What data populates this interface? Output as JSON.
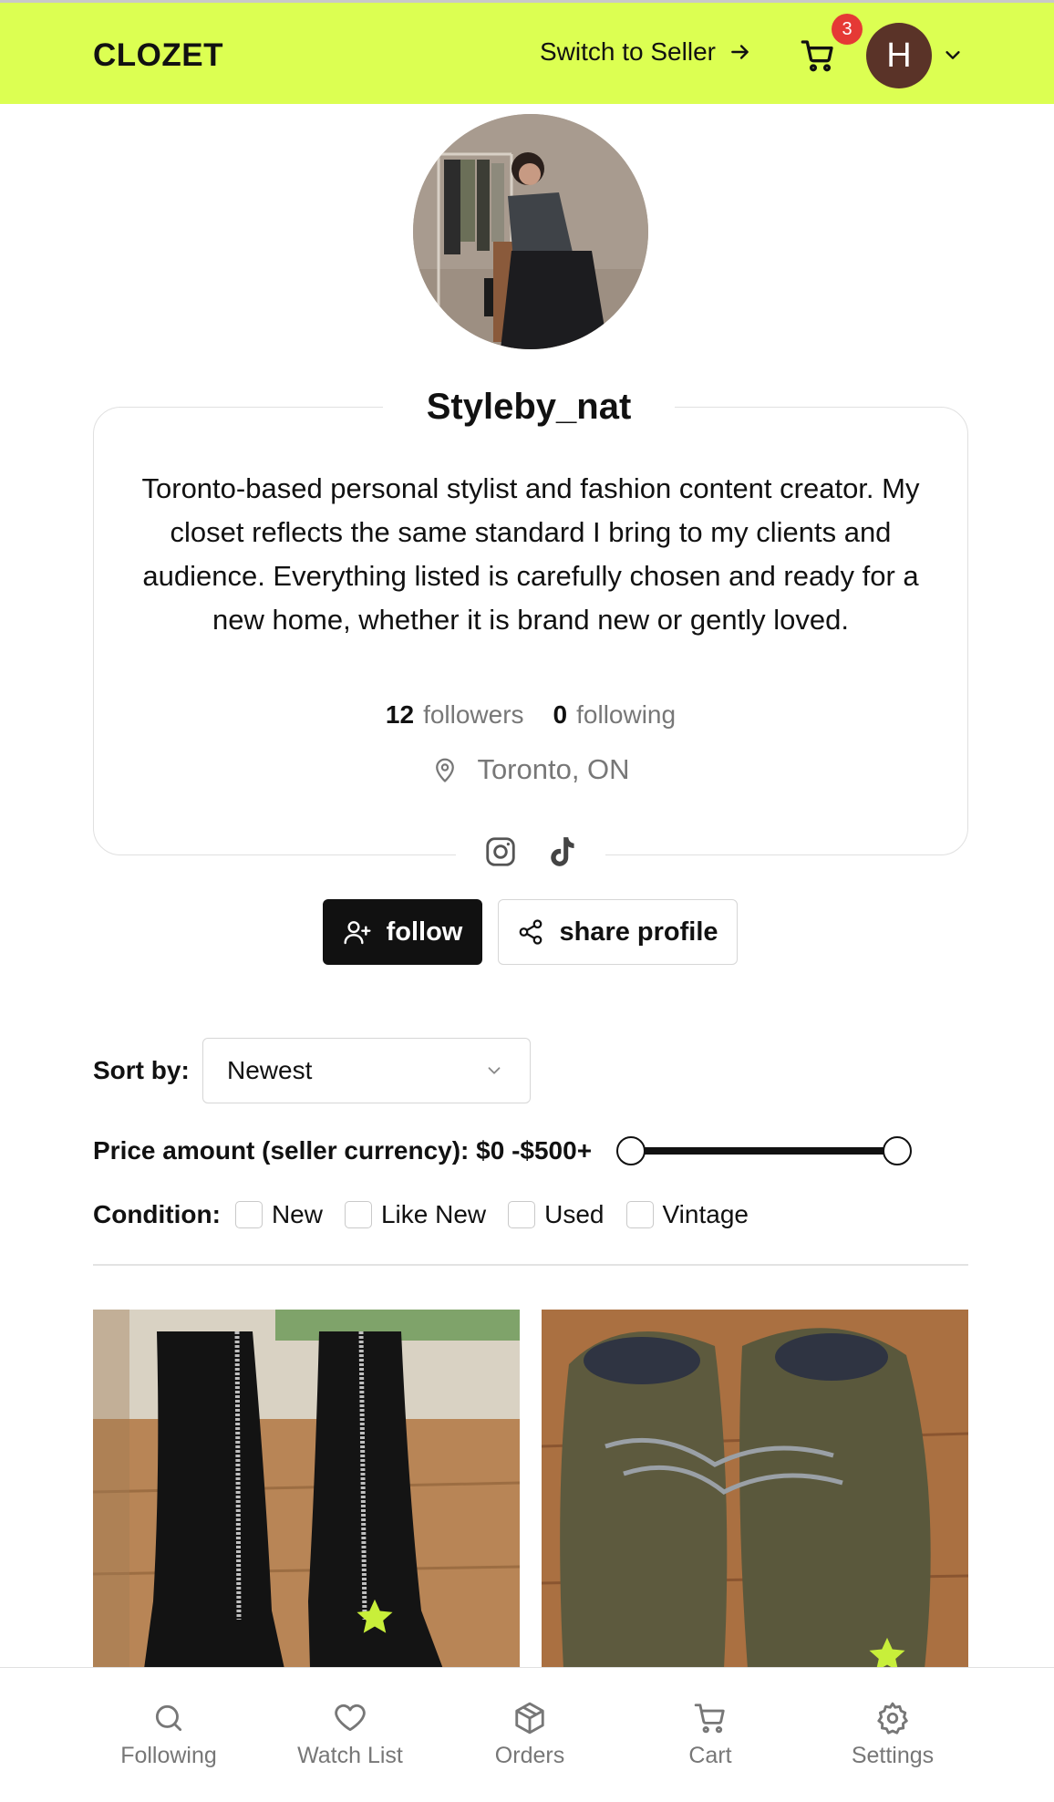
{
  "header": {
    "brand": "CLOZET",
    "switch_label": "Switch to Seller",
    "cart_count": "3",
    "user_initial": "H"
  },
  "profile": {
    "username": "Styleby_nat",
    "bio": "Toronto-based personal stylist and fashion content creator. My closet reflects the same standard I bring to my clients and audience.  Everything listed is carefully chosen and ready for a new home, whether it is brand new or gently loved.",
    "followers_count": "12",
    "followers_label": "followers",
    "following_count": "0",
    "following_label": "following",
    "location": "Toronto, ON",
    "socials": [
      "instagram-icon",
      "tiktok-icon"
    ],
    "follow_label": "follow",
    "share_label": "share profile"
  },
  "filters": {
    "sort_label": "Sort by:",
    "sort_value": "Newest",
    "price_label": "Price amount (seller currency): $0 -$500+",
    "price_range": [
      0,
      500
    ],
    "condition_label": "Condition:",
    "conditions": [
      {
        "label": "New",
        "checked": false
      },
      {
        "label": "Like New",
        "checked": false
      },
      {
        "label": "Used",
        "checked": false
      },
      {
        "label": "Vintage",
        "checked": false
      }
    ]
  },
  "listings": [
    {
      "image": "black-zip-boots-photo",
      "watched": true
    },
    {
      "image": "olive-suede-shoes-photo",
      "watched": true
    }
  ],
  "colors": {
    "accent": "#dcff52",
    "badge": "#e53935",
    "avatar": "#5a3328"
  },
  "bottom_nav": [
    {
      "label": "Following",
      "icon": "search-icon"
    },
    {
      "label": "Watch List",
      "icon": "heart-icon"
    },
    {
      "label": "Orders",
      "icon": "box-icon"
    },
    {
      "label": "Cart",
      "icon": "cart-icon"
    },
    {
      "label": "Settings",
      "icon": "gear-icon"
    }
  ]
}
